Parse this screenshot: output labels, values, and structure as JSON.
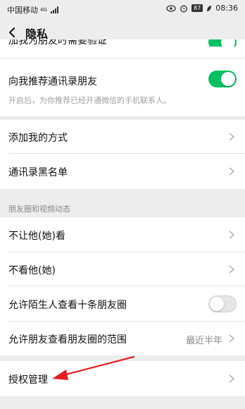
{
  "status_bar": {
    "carrier": "中国移动",
    "network": "4G",
    "battery": "87",
    "time": "08:36"
  },
  "header": {
    "title": "隐私",
    "back_icon": "chevron-left-icon"
  },
  "rows": {
    "partial_top": {
      "label": "加我为朋友时需要验证",
      "toggle": true
    },
    "recommend": {
      "label": "向我推荐通讯录朋友",
      "toggle": true,
      "description": "开启后，为你推荐已经开通微信的手机联系人。"
    },
    "add_methods": {
      "label": "添加我的方式"
    },
    "blacklist": {
      "label": "通讯录黑名单"
    }
  },
  "moments_section": {
    "header": "朋友圈和视频动态",
    "items": {
      "block_view": {
        "label": "不让他(她)看"
      },
      "hide_their": {
        "label": "不看他(她)"
      },
      "stranger_view": {
        "label": "允许陌生人查看十条朋友圈",
        "toggle": false
      },
      "range": {
        "label": "允许朋友查看朋友圈的范围",
        "value": "最近半年"
      }
    }
  },
  "authorization": {
    "label": "授权管理"
  },
  "colors": {
    "accent": "#07c160",
    "annotation_arrow": "#e02020",
    "background": "#ededed"
  }
}
